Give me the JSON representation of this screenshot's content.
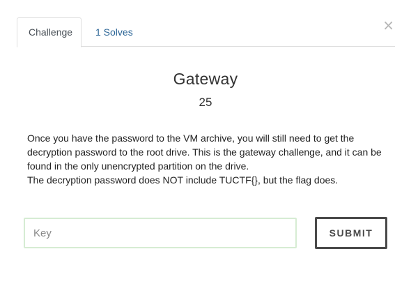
{
  "modal": {
    "close_glyph": "×",
    "close_icon": "close-icon"
  },
  "tabs": [
    {
      "label": "Challenge",
      "active": true
    },
    {
      "label": "1 Solves",
      "active": false
    }
  ],
  "challenge": {
    "name": "Gateway",
    "points": "25",
    "description": [
      "Once you have the password to the VM archive, you will still need to get the decryption password to the root drive. This is the gateway challenge, and it can be found in the only unencrypted partition on the drive.",
      "The decryption password does NOT include TUCTF{}, but the flag does."
    ]
  },
  "form": {
    "key_placeholder": "Key",
    "key_value": "",
    "submit_label": "SUBMIT"
  },
  "colors": {
    "link": "#2a6496",
    "input_border": "#d6ecd3",
    "button_border": "#4a4a4a"
  }
}
